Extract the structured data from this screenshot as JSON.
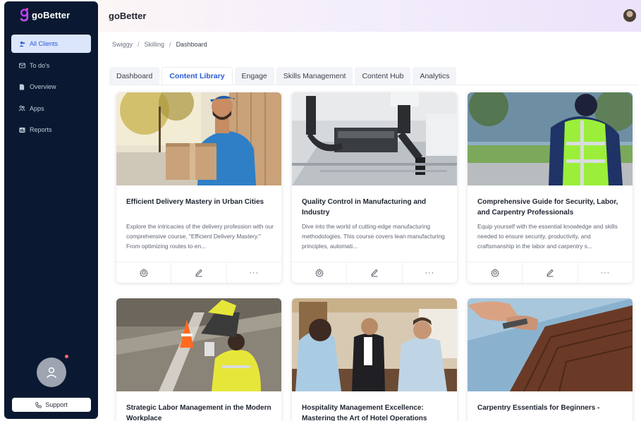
{
  "sidebar": {
    "brand": "goBetter",
    "items": [
      {
        "label": "All Clients",
        "active": true,
        "icon": "users-icon"
      },
      {
        "label": "To do's",
        "active": false,
        "icon": "mail-icon"
      },
      {
        "label": "Overview",
        "active": false,
        "icon": "file-icon"
      },
      {
        "label": "Apps",
        "active": false,
        "icon": "people-icon"
      },
      {
        "label": "Reports",
        "active": false,
        "icon": "report-icon"
      }
    ],
    "support_label": "Support"
  },
  "header": {
    "title": "goBetter"
  },
  "breadcrumb": [
    "Swiggy",
    "Skilling",
    "Dashboard"
  ],
  "tabs": [
    {
      "label": "Dashboard",
      "active": false
    },
    {
      "label": "Content Library",
      "active": true
    },
    {
      "label": "Engage",
      "active": false
    },
    {
      "label": "Skills Management",
      "active": false
    },
    {
      "label": "Content Hub",
      "active": false
    },
    {
      "label": "Analytics",
      "active": false
    }
  ],
  "cards": [
    {
      "title": "Efficient Delivery Mastery in Urban Cities",
      "description": "Explore the intricacies of the delivery profession with our comprehensive course, \"Efficient Delivery Mastery.\" From optimizing routes to en...",
      "image": "delivery-person-photo"
    },
    {
      "title": "Quality Control in Manufacturing and Industry",
      "description": "Dive into the world of cutting-edge manufacturing methodologies. This course covers lean manufacturing principles, automati...",
      "image": "robotic-arms-photo"
    },
    {
      "title": "Comprehensive Guide for Security, Labor, and Carpentry Professionals",
      "description": "Equip yourself with the essential knowledge and skills needed to ensure security, productivity, and craftsmanship in the labor and carpentry s...",
      "image": "security-guard-photo"
    },
    {
      "title": "Strategic Labor Management in the Modern Workplace",
      "description": "",
      "image": "road-workers-photo"
    },
    {
      "title": "Hospitality Management Excellence: Mastering the Art of Hotel Operations",
      "description": "",
      "image": "hotel-reception-photo"
    },
    {
      "title": "Carpentry Essentials for Beginners -",
      "description": "",
      "image": "wood-flooring-photo"
    }
  ],
  "colors": {
    "sidebar_bg": "#0a1931",
    "accent": "#2a5bd7",
    "active_nav_bg": "#dce6fb"
  }
}
